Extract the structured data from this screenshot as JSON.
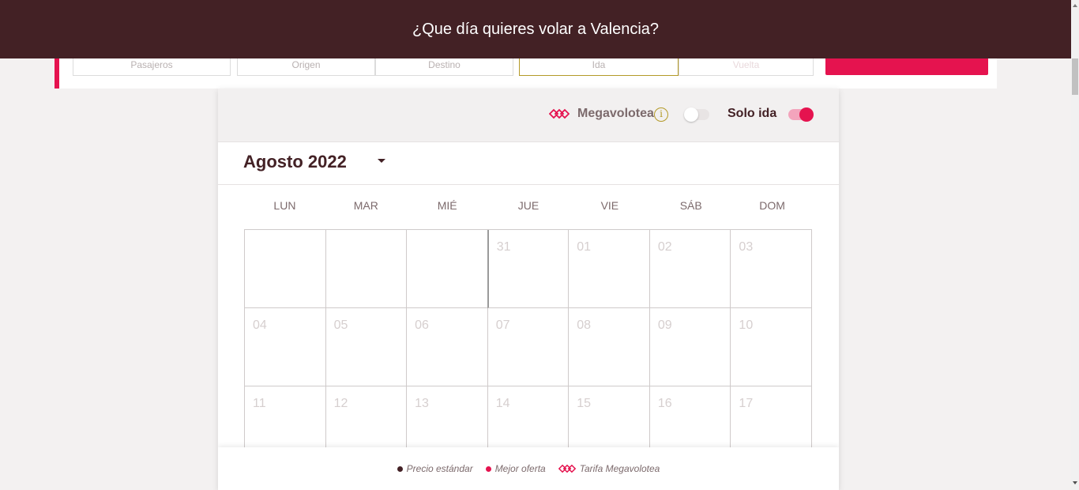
{
  "header": {
    "title": "¿Que día quieres volar a Valencia?"
  },
  "search": {
    "passengers_label": "Pasajeros",
    "origin_label": "Origen",
    "destination_label": "Destino",
    "departure_label": "Ida",
    "return_label": "Vuelta"
  },
  "options": {
    "megavolotea_label": "Megavolotea",
    "megavolotea_enabled": false,
    "one_way_label": "Solo ida",
    "one_way_enabled": true
  },
  "calendar": {
    "month_label": "Agosto 2022",
    "weekdays": [
      "LUN",
      "MAR",
      "MIÉ",
      "JUE",
      "VIE",
      "SÁB",
      "DOM"
    ],
    "days": [
      "",
      "",
      "",
      "31",
      "01",
      "02",
      "03",
      "04",
      "05",
      "06",
      "07",
      "08",
      "09",
      "10",
      "11",
      "12",
      "13",
      "14",
      "15",
      "16",
      "17"
    ]
  },
  "legend": {
    "standard": "Precio estándar",
    "best": "Mejor oferta",
    "mega": "Tarifa Megavolotea"
  },
  "colors": {
    "brand_dark": "#432125",
    "brand_pink": "#e5134f",
    "accent_gold": "#b49a28"
  },
  "icons": {
    "megavolotea_logo": "megavolotea-logo-icon",
    "info": "info-icon",
    "dropdown": "chevron-down-icon"
  }
}
